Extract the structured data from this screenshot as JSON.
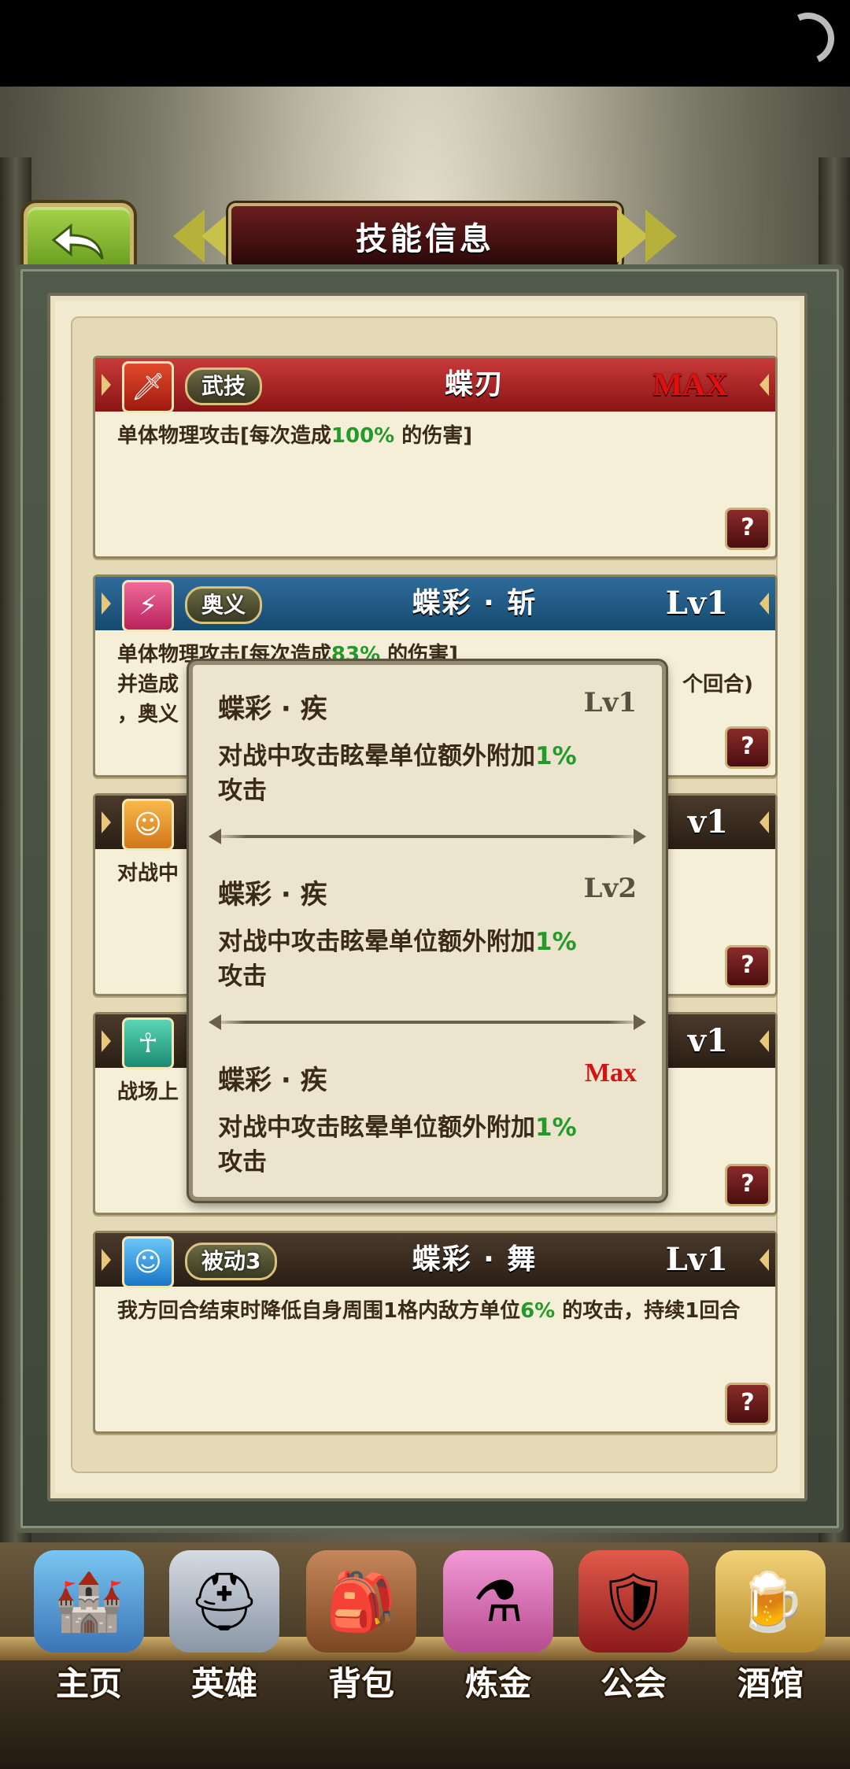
{
  "title": "技能信息",
  "skills": [
    {
      "tag": "武技",
      "name": "蝶刃",
      "level": "MAX",
      "icon": "sword-icon",
      "desc": [
        [
          "单体物理攻击[每次造成",
          ""
        ],
        [
          "100%",
          "g"
        ],
        [
          " 的伤害]",
          ""
        ]
      ]
    },
    {
      "tag": "奥义",
      "name": "蝶彩 · 斩",
      "level": "Lv1",
      "icon": "slash-icon",
      "desc": [
        [
          "单体物理攻击[每次造成",
          ""
        ],
        [
          "83%",
          "g"
        ],
        [
          " 的伤害]",
          ""
        ]
      ],
      "desc2": "并造成",
      "desc2_tail": "个回合)",
      "desc3": "，奥义"
    },
    {
      "tag": "",
      "name": "",
      "level": "v1",
      "icon": "person-icon",
      "desc": [
        [
          "对战中",
          ""
        ]
      ]
    },
    {
      "tag": "",
      "name": "",
      "level": "v1",
      "icon": "aura-icon",
      "desc": [
        [
          "战场上",
          ""
        ]
      ]
    },
    {
      "tag": "被动3",
      "name": "蝶彩 · 舞",
      "level": "Lv1",
      "icon": "sparkle-person-icon",
      "desc": [
        [
          "我方回合结束时降低自身周围1格内敌方单位",
          ""
        ],
        [
          "6%",
          "g"
        ],
        [
          " 的攻击，持续1回合",
          ""
        ]
      ]
    }
  ],
  "popup": {
    "entries": [
      {
        "name": "蝶彩 · 疾",
        "level": "Lv1",
        "desc_prefix": "对战中攻击眩晕单位额外附加",
        "desc_value": "1%",
        "desc_suffix": "攻击"
      },
      {
        "name": "蝶彩 · 疾",
        "level": "Lv2",
        "desc_prefix": "对战中攻击眩晕单位额外附加",
        "desc_value": "1%",
        "desc_suffix": "攻击"
      },
      {
        "name": "蝶彩 · 疾",
        "level": "Max",
        "desc_prefix": "对战中攻击眩晕单位额外附加",
        "desc_value": "1%",
        "desc_suffix": "攻击"
      }
    ]
  },
  "help_label": "?",
  "nav": [
    {
      "label": "主页",
      "icon": "castle-icon"
    },
    {
      "label": "英雄",
      "icon": "helmet-icon"
    },
    {
      "label": "背包",
      "icon": "backpack-icon"
    },
    {
      "label": "炼金",
      "icon": "potion-icon"
    },
    {
      "label": "公会",
      "icon": "shield-icon"
    },
    {
      "label": "酒馆",
      "icon": "beer-mug-icon"
    }
  ],
  "colors": {
    "accent_green": "#249a2a",
    "max_red": "#e01010"
  }
}
